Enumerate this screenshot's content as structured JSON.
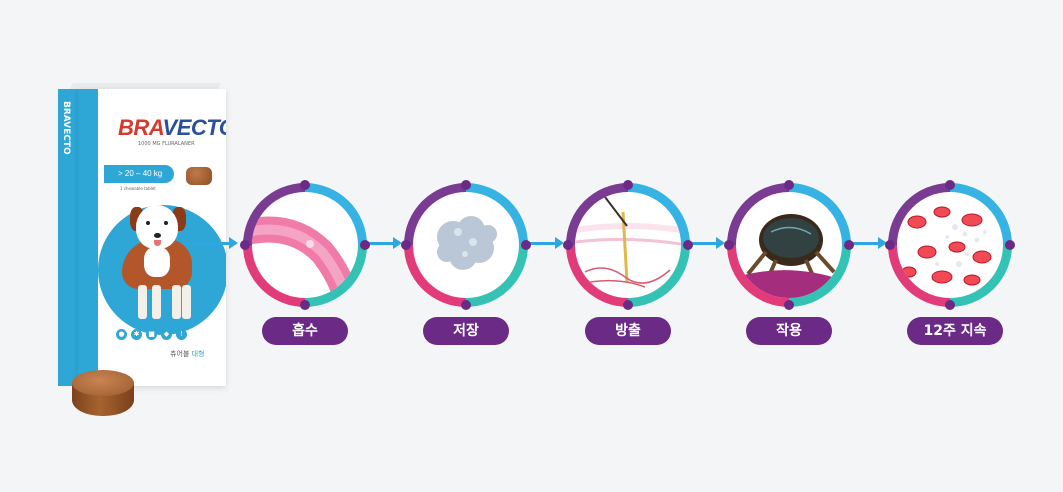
{
  "product": {
    "brand_part1": "BRA",
    "brand_part2": "VECTO",
    "brand_tm": "®",
    "dose": "1000 MG FLURALANER",
    "weight_range": "> 20 – 40 kg",
    "chew_count": "1 chewable tablet",
    "caption_prefix": "츄어블",
    "caption_highlight": "대형",
    "spine_text": "BRAVECTO"
  },
  "steps": [
    {
      "label": "흡수",
      "icon": "blood-vessel-icon"
    },
    {
      "label": "저장",
      "icon": "protein-molecule-icon"
    },
    {
      "label": "방출",
      "icon": "skin-layer-icon"
    },
    {
      "label": "작용",
      "icon": "tick-icon"
    },
    {
      "label": "12주 지속",
      "icon": "blood-cells-icon"
    }
  ],
  "colors": {
    "ring_blue": "#36b3e2",
    "ring_teal": "#33c2b4",
    "ring_pink": "#e23b7a",
    "ring_purple": "#7a3b92",
    "label_bg": "#6a2a86",
    "arrow": "#2ea6e0",
    "brand_red": "#d53a2f",
    "box_blue": "#2ea6d6"
  }
}
